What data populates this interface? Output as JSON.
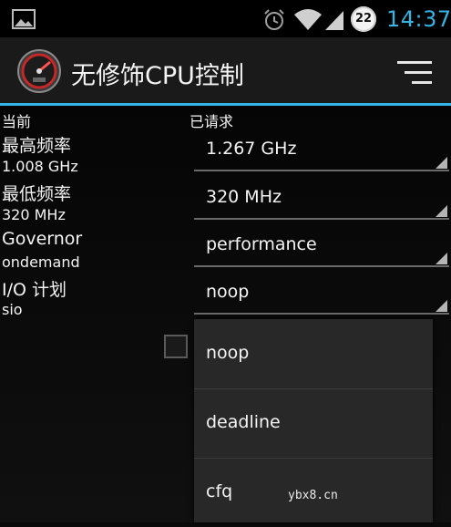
{
  "status_bar": {
    "time": "14:37",
    "notification_count": "22",
    "icons": [
      "image-icon",
      "alarm-icon",
      "wifi-icon",
      "signal-icon"
    ],
    "accent_color": "#33b5e5"
  },
  "action_bar": {
    "title": "无修饰CPU控制",
    "logo_icon": "speedometer-icon",
    "menu_icon": "overflow-menu-icon"
  },
  "columns": {
    "current": "当前",
    "requested": "已请求"
  },
  "current": {
    "max_freq_label": "最高频率",
    "max_freq_value": "1.008 GHz",
    "min_freq_label": "最低频率",
    "min_freq_value": "320 MHz",
    "governor_label": "Governor",
    "governor_value": "ondemand",
    "io_label": "I/O 计划",
    "io_value": "sio"
  },
  "requested": {
    "max_freq": "1.267 GHz",
    "min_freq": "320 MHz",
    "governor": "performance",
    "io_scheduler": "noop"
  },
  "dropdown": {
    "options": [
      "noop",
      "deadline",
      "cfq"
    ]
  },
  "watermark": "ybx8.cn"
}
